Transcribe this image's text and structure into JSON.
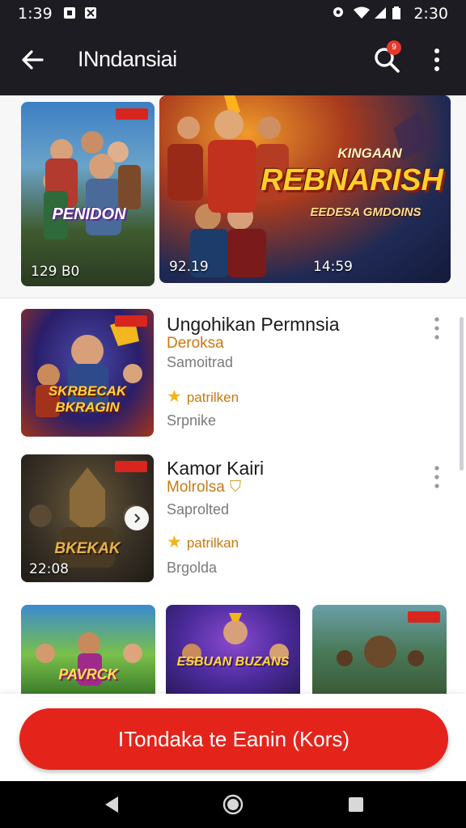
{
  "status_bar": {
    "time_left": "1:39",
    "time_right": "2:30"
  },
  "app_bar": {
    "title": "INndansiai",
    "notification_count": "9",
    "icons": [
      "back-arrow-icon",
      "search-icon",
      "more-vert-icon"
    ]
  },
  "hero": {
    "left_card": {
      "art_text": "PENIDON",
      "label": "129 B0"
    },
    "right_card": {
      "art_top": "KINGAAN",
      "art_title": "REBNARISH",
      "art_sub": "EEDESA GMDOINS",
      "label_left": "92.19",
      "label_right": "14:59"
    }
  },
  "list": [
    {
      "title": "Ungohikan Permnsia",
      "subtitle": "Deroksa",
      "meta": "Samoitrad",
      "rating": "patrilken",
      "footer": "Srpnike",
      "art_text": "SKRBECAK BKRAGIN"
    },
    {
      "title": "Kamor Kairi",
      "subtitle": "Molrolsa",
      "meta": "Saprolted",
      "rating": "patrilkan",
      "footer": "Brgolda",
      "art_text": "BKEKAK",
      "label": "22:08"
    }
  ],
  "grid": [
    {
      "art_text": "PAVRCK"
    },
    {
      "art_text": "ESBUAN BUZANS"
    },
    {
      "art_text": ""
    }
  ],
  "cta": {
    "label": "ITondaka te Eanin (Kors)"
  },
  "colors": {
    "bar_bg": "#1c1c22",
    "accent_red": "#e4241b",
    "rating_orange": "#c77a12",
    "star": "#f2b417"
  }
}
